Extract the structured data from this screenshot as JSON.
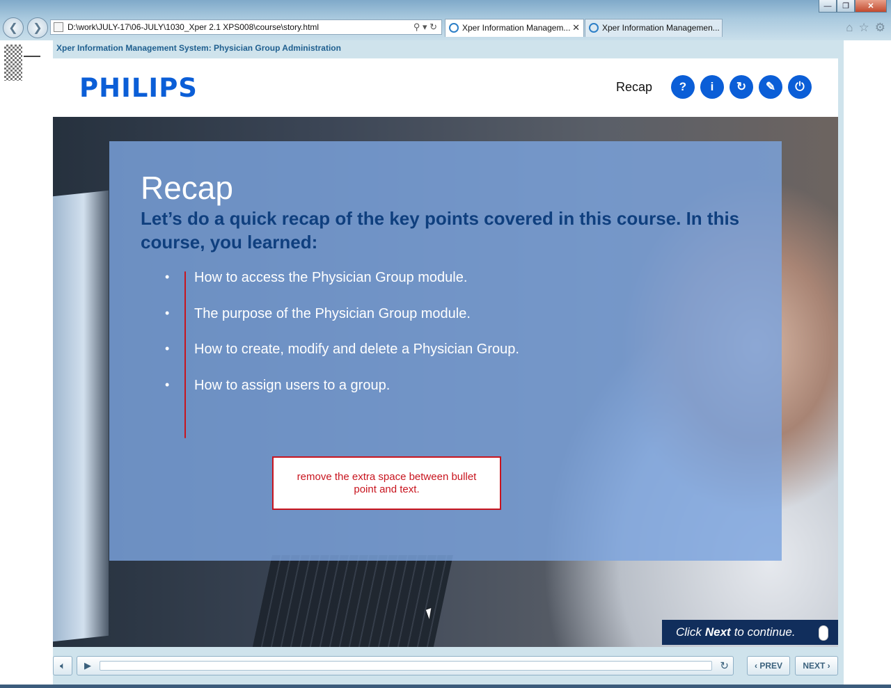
{
  "browser": {
    "address": "D:\\work\\JULY-17\\06-JULY\\1030_Xper 2.1 XPS008\\course\\story.html",
    "tabs": [
      {
        "label": "Xper Information Managem..."
      },
      {
        "label": "Xper Information Managemen..."
      }
    ],
    "window_buttons": {
      "minimize": "—",
      "restore": "❐",
      "close": "✕"
    },
    "icons": [
      "back-icon",
      "forward-icon",
      "search-icon",
      "refresh-icon",
      "home-icon",
      "favorites-icon",
      "settings-icon"
    ]
  },
  "course": {
    "title": "Xper Information Management System: Physician Group Administration",
    "logo": "PHILIPS",
    "section_label": "Recap",
    "header_icons": [
      "help-icon",
      "info-icon",
      "replay-icon",
      "resources-icon",
      "exit-icon"
    ],
    "header_icon_glyphs": [
      "?",
      "i",
      "↻",
      "✎",
      "⏻"
    ],
    "accent_color": "#0b5ed7"
  },
  "slide": {
    "title": "Recap",
    "subtitle": "Let’s do a quick recap of the key points covered in this course. In this course, you learned:",
    "bullets": [
      "How to access the Physician Group module.",
      "The purpose of the Physician Group module.",
      "How to create, modify and delete a Physician Group.",
      "How to assign users to a group."
    ],
    "review_note": "remove the extra space between bullet point and text.",
    "cta": {
      "prefix": "Click",
      "bold": "Next",
      "suffix": "to continue."
    }
  },
  "player": {
    "prev_label": "PREV",
    "next_label": "NEXT"
  }
}
